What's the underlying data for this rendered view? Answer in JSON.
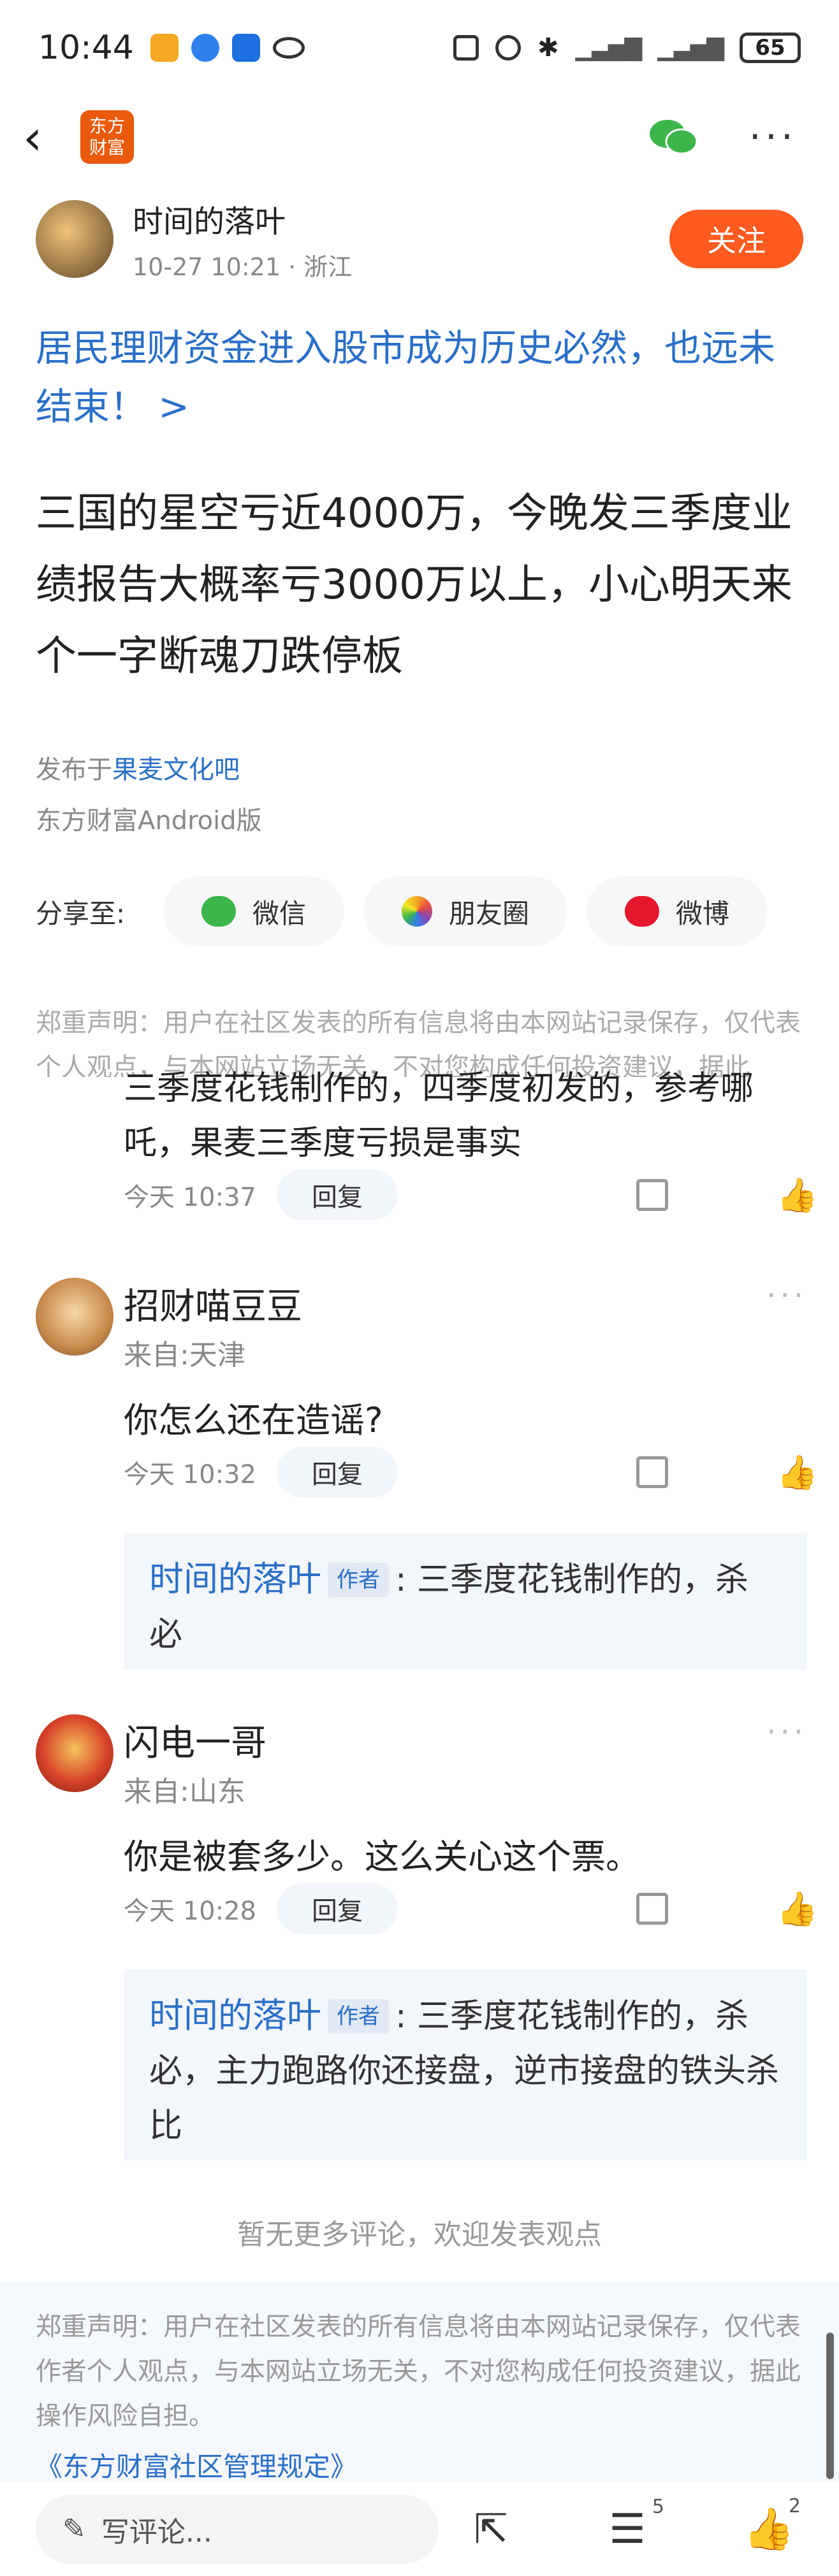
{
  "status_bar": {
    "time": "10:44",
    "battery": "65"
  },
  "nav": {
    "logo_line1": "东方",
    "logo_line2": "财富"
  },
  "author": {
    "name": "时间的落叶",
    "meta": "10-27 10:21 · 浙江",
    "follow_label": "关注"
  },
  "headline": "居民理财资金进入股市成为历史必然，也远未结束！ >",
  "body": "三国的星空亏近4000万，今晚发三季度业绩报告大概率亏3000万以上，小心明天来个一字断魂刀跌停板",
  "post_in_prefix": "发布于",
  "post_in_bar": "果麦文化吧",
  "source": "东方财富Android版",
  "share": {
    "label": "分享至:",
    "wechat": "微信",
    "moments": "朋友圈",
    "weibo": "微博"
  },
  "disclaimer_top": "郑重声明：用户在社区发表的所有信息将由本网站记录保存，仅代表个人观点，与本网站立场无关，不对您构成任何投资建议，据此",
  "comment_fragment": "三季度花钱制作的，四季度初发的，参考哪吒，果麦三季度亏损是事实",
  "comment_fragment_time": "今天 10:37",
  "reply_label": "回复",
  "comments": [
    {
      "name": "招财喵豆豆",
      "from": "来自:天津",
      "text": "你怎么还在造谣?",
      "time": "今天 10:32",
      "quote_name": "时间的落叶",
      "quote_tag": "作者",
      "quote_text": ": 三季度花钱制作的，杀必"
    },
    {
      "name": "闪电一哥",
      "from": "来自:山东",
      "text": "你是被套多少。这么关心这个票。",
      "time": "今天 10:28",
      "quote_name": "时间的落叶",
      "quote_tag": "作者",
      "quote_text": ": 三季度花钱制作的，杀必，主力跑路你还接盘，逆市接盘的铁头杀比"
    }
  ],
  "no_more": "暂无更多评论，欢迎发表观点",
  "disclaimer_bottom": "郑重声明：用户在社区发表的所有信息将由本网站记录保存，仅代表作者个人观点，与本网站立场无关，不对您构成任何投资建议，据此操作风险自担。",
  "rules_link": "《东方财富社区管理规定》",
  "bottom_bar": {
    "comment_placeholder": "写评论...",
    "comment_count": "5",
    "like_count": "2"
  },
  "colors": {
    "accent_orange": "#ff5a1f",
    "link_blue": "#2a6fc9"
  }
}
